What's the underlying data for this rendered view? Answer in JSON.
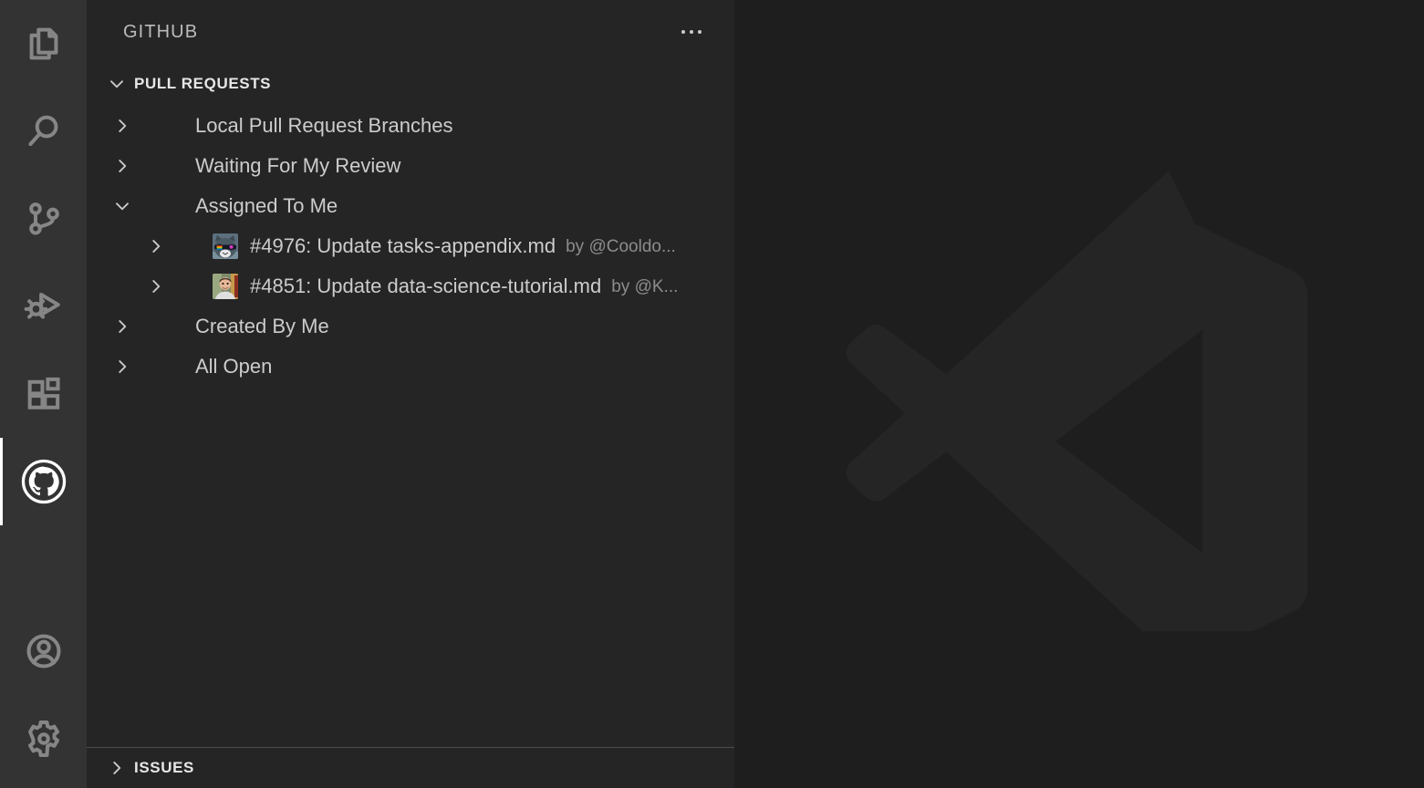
{
  "window": {
    "editor_background": "#1e1e1e",
    "sidebar_background": "#252526",
    "activitybar_background": "#333333",
    "accent": "#ffffff"
  },
  "activity_bar": {
    "items": [
      {
        "name": "explorer",
        "icon": "files-icon",
        "tooltip": "Explorer",
        "active": false
      },
      {
        "name": "search",
        "icon": "search-icon",
        "tooltip": "Search",
        "active": false
      },
      {
        "name": "source-control",
        "icon": "source-control-icon",
        "tooltip": "Source Control",
        "active": false
      },
      {
        "name": "run-and-debug",
        "icon": "run-and-debug-icon",
        "tooltip": "Run and Debug",
        "active": false
      },
      {
        "name": "extensions",
        "icon": "extensions-icon",
        "tooltip": "Extensions",
        "active": false
      },
      {
        "name": "github",
        "icon": "github-icon",
        "tooltip": "GitHub",
        "active": true
      }
    ],
    "bottom_items": [
      {
        "name": "accounts",
        "icon": "account-icon",
        "tooltip": "Accounts"
      },
      {
        "name": "manage",
        "icon": "gear-icon",
        "tooltip": "Manage"
      }
    ]
  },
  "sidebar": {
    "title": "GITHUB",
    "more_actions_label": "...",
    "panes": [
      {
        "id": "pull-requests",
        "title": "PULL REQUESTS",
        "expanded": true,
        "twisty": "chevron-down-icon"
      },
      {
        "id": "issues",
        "title": "ISSUES",
        "expanded": false,
        "twisty": "chevron-right-icon"
      }
    ],
    "pull_requests": {
      "categories": [
        {
          "label": "Local Pull Request Branches",
          "expanded": false,
          "twisty": "chevron-right-icon",
          "children": []
        },
        {
          "label": "Waiting For My Review",
          "expanded": false,
          "twisty": "chevron-right-icon",
          "children": []
        },
        {
          "label": "Assigned To Me",
          "expanded": true,
          "twisty": "chevron-down-icon",
          "children": [
            {
              "label": "#4976: Update tasks-appendix.md",
              "author": "by @Cooldo...",
              "avatar": "cat-sunglasses-avatar",
              "twisty": "chevron-right-icon"
            },
            {
              "label": "#4851: Update data-science-tutorial.md",
              "author": "by @K...",
              "avatar": "person-photo-avatar",
              "twisty": "chevron-right-icon"
            }
          ]
        },
        {
          "label": "Created By Me",
          "expanded": false,
          "twisty": "chevron-right-icon",
          "children": []
        },
        {
          "label": "All Open",
          "expanded": false,
          "twisty": "chevron-right-icon",
          "children": []
        }
      ]
    }
  },
  "editor": {
    "watermark_icon": "vscode-logo-watermark"
  }
}
